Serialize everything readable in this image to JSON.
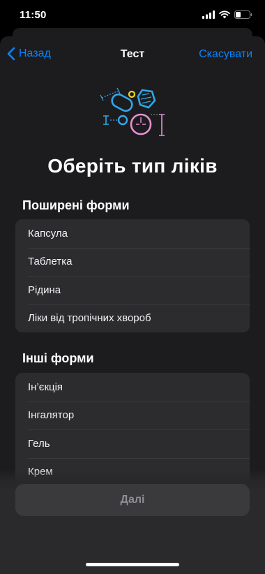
{
  "status_bar": {
    "time": "11:50",
    "icons": [
      "cellular-signal-icon",
      "wifi-icon",
      "battery-icon"
    ]
  },
  "nav": {
    "back_label": "Назад",
    "title": "Тест",
    "cancel_label": "Скасувати"
  },
  "hero": {
    "icon": "medication-shapes-illustration",
    "colors": {
      "blue": "#2fa8e8",
      "yellow": "#f2d31b",
      "pink": "#e48fd4",
      "grey": "#8e8e93"
    }
  },
  "page_title": "Оберіть тип ліків",
  "common_forms": {
    "header": "Поширені форми",
    "items": [
      "Капсула",
      "Таблетка",
      "Рідина",
      "Ліки від тропічних хвороб"
    ]
  },
  "other_forms": {
    "header": "Інші форми",
    "items": [
      "Ін’єкція",
      "Інгалятор",
      "Гель",
      "Крем"
    ]
  },
  "footer": {
    "next_label": "Далі"
  },
  "colors": {
    "accent": "#0a84ff",
    "sheet_background": "#1c1c1e",
    "cell_background": "#2c2c2e",
    "disabled_button": "#3a3a3c",
    "disabled_text": "#8e8e93"
  }
}
